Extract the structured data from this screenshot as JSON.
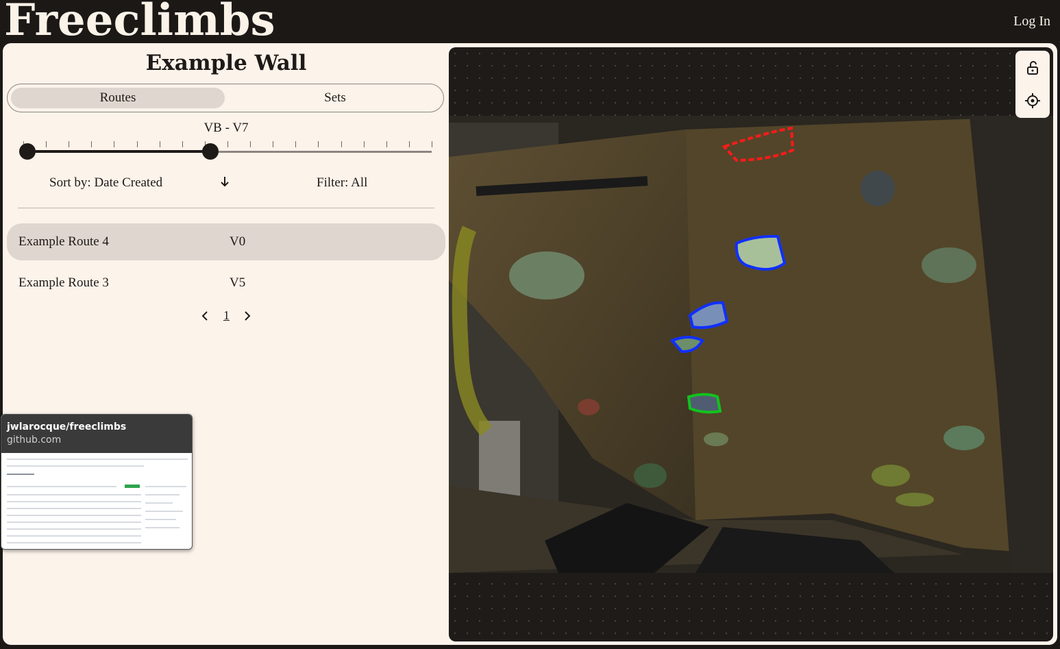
{
  "header": {
    "brand": "Freeclimbs",
    "login": "Log In"
  },
  "wall": {
    "title": "Example Wall"
  },
  "tabs": [
    {
      "label": "Routes",
      "active": true
    },
    {
      "label": "Sets",
      "active": false
    }
  ],
  "grade_filter": {
    "label": "VB - V7",
    "min_index": 0,
    "max_index": 8,
    "steps": 18
  },
  "sort": {
    "label": "Sort by: Date Created",
    "direction": "descending"
  },
  "filter": {
    "label": "Filter: All"
  },
  "routes": [
    {
      "name": "Example Route 4",
      "grade": "V0",
      "selected": true
    },
    {
      "name": "Example Route 3",
      "grade": "V5",
      "selected": false
    }
  ],
  "pagination": {
    "current": "1"
  },
  "link_preview": {
    "title": "jwlarocque/freeclimbs",
    "domain": "github.com"
  },
  "toolbar": {
    "tools": [
      "unlock-icon",
      "locate-icon"
    ]
  },
  "colors": {
    "background": "#1b1816",
    "panel": "#fcf3ea",
    "accent": "#ded6cf",
    "hold_start": "#12c21e",
    "hold_hand": "#1030ff",
    "hold_finish": "#ff1a1a"
  }
}
